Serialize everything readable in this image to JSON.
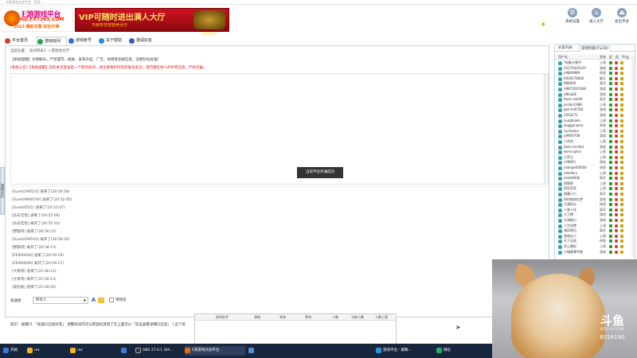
{
  "window": {
    "title": "E游游戏对战平台 - 官网 ..."
  },
  "logo": {
    "line1": "E游游戏平台",
    "line2": "HD.FXT365.COM",
    "line3": "2013 精彩无限 好玩不停"
  },
  "banner": {
    "main": "VIP可随时进出满人大厅",
    "sub": "不用辛辛苦苦养大厅",
    "crest_text": "E游对战平台"
  },
  "top_buttons": [
    {
      "icon": "gear-icon",
      "label": "系统设置"
    },
    {
      "icon": "house-icon",
      "label": "进入大厅"
    },
    {
      "icon": "exit-icon",
      "label": "退出平台"
    }
  ],
  "tabs": [
    {
      "label": "平台首页",
      "color": "#d23a2a"
    },
    {
      "label": "游戏房间",
      "color": "#2aa04a"
    },
    {
      "label": "游戏帐号",
      "color": "#3a6ad2"
    },
    {
      "label": "关于帮助",
      "color": "#2a8ad2"
    },
    {
      "label": "邀请好友",
      "color": "#3a5ab8"
    }
  ],
  "breadcrumb": "当前位置：  房间列表1   →  游戏场大厅",
  "notice1": "【系统提醒】文明聊天，严禁谩骂、刷屏、发布外挂、广告、色情等违规信息，违者封号处理！",
  "notice2": "[系统公告]【系统提醒】您的本次登录是一个新的房间，请注意保护好您的账号安全；请勿相信他人的中奖信息，严防诈骗。",
  "toast": "当前平台开通成功",
  "entries": [
    "[Guest299510] 进来了(20:50:58)",
    "[Guest9800530] 进来了(20:52:45)",
    "[Guest4521] 进来了(20:53:47)",
    "[乐乐无忧] 进来了(20:55:08)",
    "[乐乐无忧] 离开了(20:55:10)",
    "[野狼哥] 进来了(20:56:23)",
    "[Guest299510] 离开了(20:56:30)",
    "[野狼哥] 离开了(20:58:13)",
    "[EE000000] 进来了(20:59:16)",
    "[EE000000] 离开了(20:59:17)",
    "[大哥哥] 进来了(21:00:12)",
    "[大哥哥] 离开了(21:00:13)",
    "[奥利奥] 进来了(21:00:42)"
  ],
  "input_row": {
    "label": "发送给",
    "target": "所有人",
    "checkbox_label": "悄悄话"
  },
  "tip": "提示：按键F1 「发送口信给好友」   调整房间内可以把鼠标放到了在上面可以「双击查看详细口信息」  ) 这个房",
  "left_strip": "游戏大厅",
  "right_panel": {
    "tabs": [
      "好友列表",
      "游戏玩家(FS/28)"
    ],
    "headers": [
      "用户名",
      "状态",
      "延",
      "组",
      "Ping"
    ],
    "users": [
      {
        "name": "*电脑卡顿中",
        "status": "上网"
      },
      {
        "name": "20170420105",
        "status": "游戏"
      },
      {
        "name": "a9809989",
        "status": "休息"
      },
      {
        "name": "9400578660",
        "status": "聊天"
      },
      {
        "name": "888006",
        "status": "离开"
      },
      {
        "name": "a9870297008",
        "status": "游戏"
      },
      {
        "name": "dl8aaEE",
        "status": "游戏"
      },
      {
        "name": "Rose-real40",
        "status": "离开"
      },
      {
        "name": "jordan1988",
        "status": "上网"
      },
      {
        "name": "gao-ho6708",
        "status": "游戏"
      },
      {
        "name": "2203271",
        "status": "游戏"
      },
      {
        "name": "kungfulolo",
        "status": "上网"
      },
      {
        "name": "waggyname",
        "status": "休息"
      },
      {
        "name": "sychaoka",
        "status": "上网"
      },
      {
        "name": "a9960708",
        "status": "游戏"
      },
      {
        "name": "小杰杰",
        "status": "上网"
      },
      {
        "name": "Sala-minifad",
        "status": "游戏"
      },
      {
        "name": "weria-gelin",
        "status": "上网"
      },
      {
        "name": "小乔玉",
        "status": "上网"
      },
      {
        "name": "s39693",
        "status": "游戏"
      },
      {
        "name": "alianget00000",
        "status": "休息"
      },
      {
        "name": "sdeditco",
        "status": "上网"
      },
      {
        "name": "ahda000b",
        "status": "离开"
      },
      {
        "name": "阿胖胖",
        "status": "上网"
      },
      {
        "name": "阿旺旺旺",
        "status": "上网"
      },
      {
        "name": "寂寞小小",
        "status": "离开"
      },
      {
        "name": "时时刻刻在梦",
        "status": "游戏"
      },
      {
        "name": "大漠风沙",
        "status": "休息"
      },
      {
        "name": "人来人往",
        "status": "离开"
      },
      {
        "name": "大卫德",
        "status": "游戏"
      },
      {
        "name": "大海航行",
        "status": "游戏"
      },
      {
        "name": "人生如梦",
        "status": "上网"
      },
      {
        "name": "清风明月",
        "status": "离开"
      },
      {
        "name": "游戏达人",
        "status": "上网"
      },
      {
        "name": "天下无双",
        "status": "休息"
      },
      {
        "name": "开心就好",
        "status": "上网"
      },
      {
        "name": "小城故事今夜",
        "status": "游戏"
      }
    ]
  },
  "popup": {
    "headers": [
      "房间名字",
      "游戏",
      "状态",
      "等待",
      "人数",
      "当前人数",
      "人数上限"
    ]
  },
  "taskbar": [
    {
      "label": "开始",
      "color": "#3a7bd5"
    },
    {
      "label": "rec",
      "color": "#f0b429"
    },
    {
      "label": "rec",
      "color": "#f0b429"
    },
    {
      "label": "",
      "color": "#3a7bd5"
    },
    {
      "label": "OBS 27.0.1 (64...",
      "color": "#302e31"
    },
    {
      "label": "E游游戏对战平台...",
      "color": "#e06b18"
    },
    {
      "label": "",
      "color": "#5a8ad5"
    },
    {
      "label": "游戏平台 - 群聊...",
      "color": "#2a9bd5"
    },
    {
      "label": "微信",
      "color": "#2aae67"
    }
  ],
  "watermark": {
    "brand": "斗鱼",
    "url": "DOUYU.COM",
    "room": "6016190"
  }
}
